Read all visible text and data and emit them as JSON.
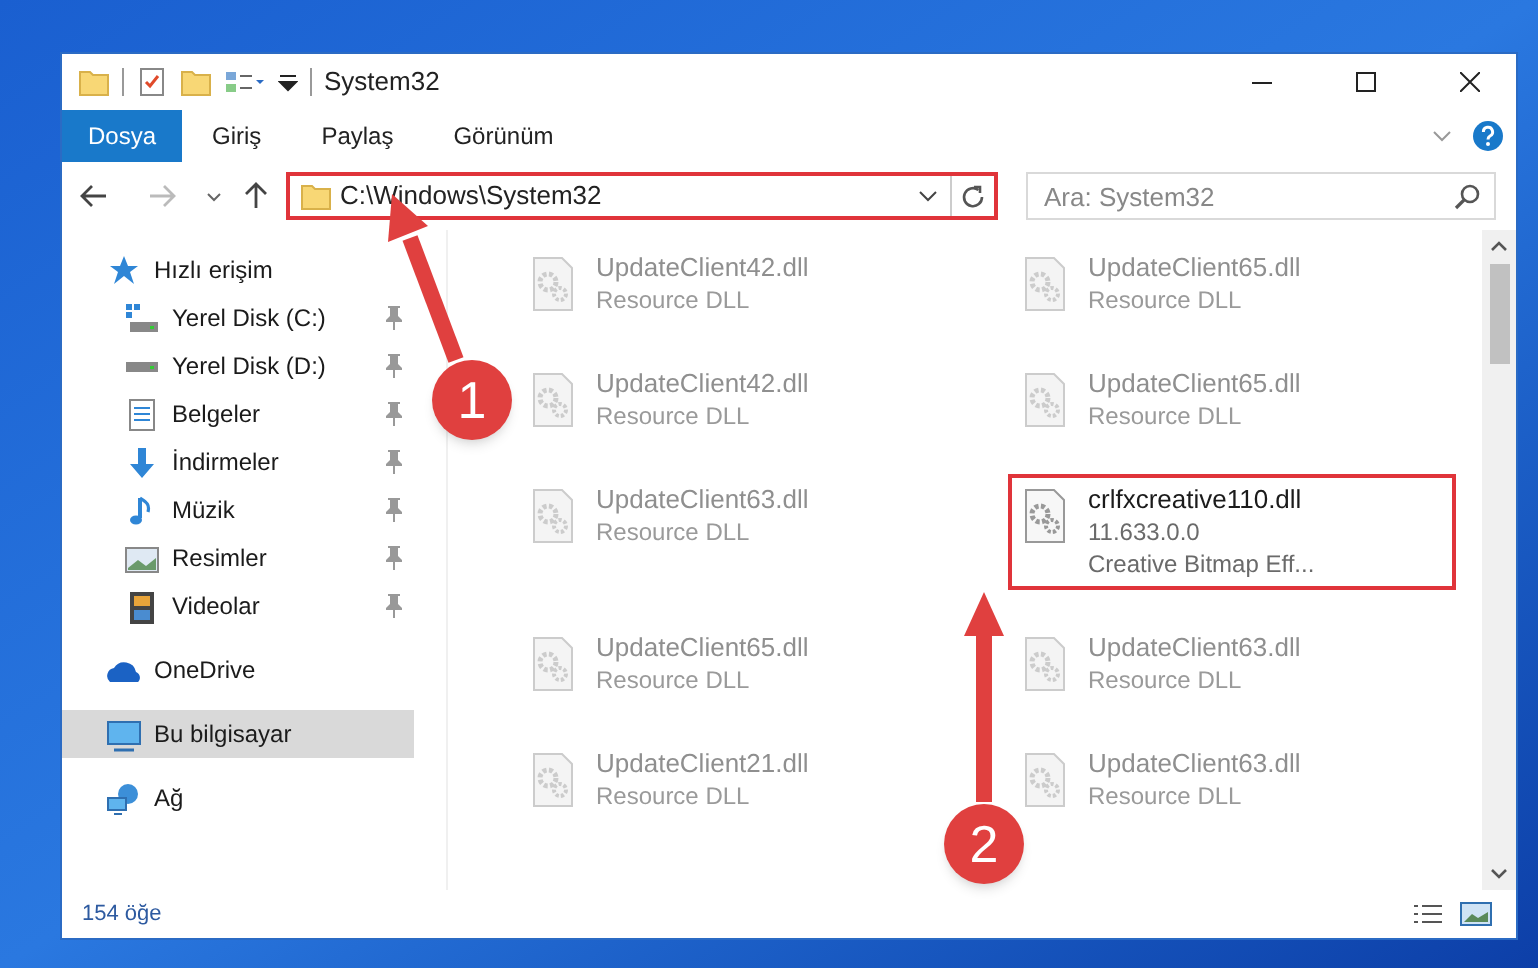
{
  "window": {
    "title": "System32"
  },
  "ribbon_tabs": [
    {
      "label": "Dosya",
      "kind": "file_menu"
    },
    {
      "label": "Giriş",
      "kind": "tab"
    },
    {
      "label": "Paylaş",
      "kind": "tab"
    },
    {
      "label": "Görünüm",
      "kind": "tab"
    }
  ],
  "address_bar": {
    "path": "C:\\Windows\\System32",
    "highlighted": true
  },
  "search": {
    "placeholder": "Ara: System32"
  },
  "sidebar": {
    "items": [
      {
        "label": "Hızlı erişim",
        "kind": "star",
        "selected": false,
        "children": [
          {
            "label": "Yerel Disk (C:)",
            "kind": "system_drive",
            "pinned": true
          },
          {
            "label": "Yerel Disk (D:)",
            "kind": "drive",
            "pinned": true
          },
          {
            "label": "Belgeler",
            "kind": "document",
            "pinned": true
          },
          {
            "label": "İndirmeler",
            "kind": "download",
            "pinned": true
          },
          {
            "label": "Müzik",
            "kind": "music",
            "pinned": true
          },
          {
            "label": "Resimler",
            "kind": "pictures",
            "pinned": true
          },
          {
            "label": "Videolar",
            "kind": "videos",
            "pinned": true
          }
        ]
      },
      {
        "label": "OneDrive",
        "kind": "cloud",
        "selected": false
      },
      {
        "label": "Bu bilgisayar",
        "kind": "computer",
        "selected": true
      },
      {
        "label": "Ağ",
        "kind": "network",
        "selected": false
      }
    ]
  },
  "files": [
    {
      "name": "UpdateClient42.dll",
      "lines": [
        "Resource DLL"
      ],
      "blurred": true,
      "highlighted": false
    },
    {
      "name": "UpdateClient65.dll",
      "lines": [
        "Resource DLL"
      ],
      "blurred": true,
      "highlighted": false
    },
    {
      "name": "UpdateClient42.dll",
      "lines": [
        "Resource DLL"
      ],
      "blurred": true,
      "highlighted": false
    },
    {
      "name": "UpdateClient65.dll",
      "lines": [
        "Resource DLL"
      ],
      "blurred": true,
      "highlighted": false
    },
    {
      "name": "UpdateClient63.dll",
      "lines": [
        "Resource DLL"
      ],
      "blurred": true,
      "highlighted": false
    },
    {
      "name": "crlfxcreative110.dll",
      "lines": [
        "11.633.0.0",
        "Creative Bitmap Eff..."
      ],
      "blurred": false,
      "highlighted": true
    },
    {
      "name": "UpdateClient65.dll",
      "lines": [
        "Resource DLL"
      ],
      "blurred": true,
      "highlighted": false
    },
    {
      "name": "UpdateClient63.dll",
      "lines": [
        "Resource DLL"
      ],
      "blurred": true,
      "highlighted": false
    },
    {
      "name": "UpdateClient21.dll",
      "lines": [
        "Resource DLL"
      ],
      "blurred": true,
      "highlighted": false
    },
    {
      "name": "UpdateClient63.dll",
      "lines": [
        "Resource DLL"
      ],
      "blurred": true,
      "highlighted": false
    }
  ],
  "status_bar": {
    "item_count": "154 öğe"
  },
  "annotations": [
    {
      "label": "1"
    },
    {
      "label": "2"
    }
  ]
}
